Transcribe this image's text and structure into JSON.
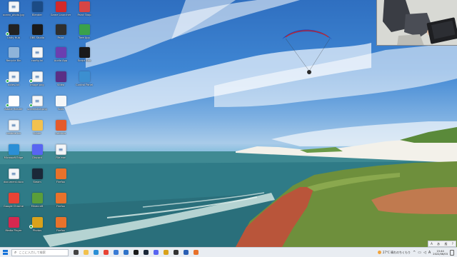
{
  "desktop": {
    "icons": [
      {
        "label": "ocean_photo.jpg",
        "icon": "file-icon",
        "color": "#f4f6f8",
        "badge": false
      },
      {
        "label": "Unity Hub",
        "icon": "unity-icon",
        "color": "#222222",
        "badge": true
      },
      {
        "label": "Recycle Bin",
        "icon": "recycle-bin-icon",
        "color": "#8fb4d9",
        "badge": false
      },
      {
        "label": "notes.txt",
        "icon": "file-icon",
        "color": "#f4f6f8",
        "badge": true
      },
      {
        "label": "Adobe Reader",
        "icon": "pdf-icon",
        "color": "#ffffff",
        "badge": true
      },
      {
        "label": "readme.txt",
        "icon": "file-icon",
        "color": "#f4f6f8",
        "badge": false
      },
      {
        "label": "Microsoft Edge",
        "icon": "edge-icon",
        "color": "#2b8fd6",
        "badge": false
      },
      {
        "label": "document.docx",
        "icon": "file-icon",
        "color": "#f4f6f8",
        "badge": false
      },
      {
        "label": "Google Chrome",
        "icon": "chrome-icon",
        "color": "#e84335",
        "badge": false
      },
      {
        "label": "Media Player",
        "icon": "media-icon",
        "color": "#d6284f",
        "badge": false
      },
      {
        "label": "Blender",
        "icon": "blender-icon",
        "color": "#1b4b85",
        "badge": false
      },
      {
        "label": "OBS Studio",
        "icon": "obs-icon",
        "color": "#1a1a1a",
        "badge": false
      },
      {
        "label": "config.ini",
        "icon": "file-icon",
        "color": "#f4f6f8",
        "badge": false
      },
      {
        "label": "image.png",
        "icon": "file-icon",
        "color": "#f4f6f8",
        "badge": true
      },
      {
        "label": "screenshot.png",
        "icon": "file-icon",
        "color": "#f4f6f8",
        "badge": true
      },
      {
        "label": "Folder",
        "icon": "folder-icon",
        "color": "#f2c14e",
        "badge": false
      },
      {
        "label": "Discord",
        "icon": "discord-icon",
        "color": "#5865f2",
        "badge": false
      },
      {
        "label": "Steam",
        "icon": "steam-icon",
        "color": "#1b2838",
        "badge": false
      },
      {
        "label": "Minecraft",
        "icon": "minecraft-icon",
        "color": "#5a9e3a",
        "badge": false
      },
      {
        "label": "Photos",
        "icon": "photos-icon",
        "color": "#d9a21b",
        "badge": true
      },
      {
        "label": "Game Launcher",
        "icon": "game-icon",
        "color": "#d2292b",
        "badge": false
      },
      {
        "label": "Paint",
        "icon": "paint-icon",
        "color": "#2f2f2f",
        "badge": false
      },
      {
        "label": "Audio App",
        "icon": "audio-icon",
        "color": "#6b3fb0",
        "badge": false
      },
      {
        "label": "Video",
        "icon": "video-icon",
        "color": "#5a2f86",
        "badge": false
      },
      {
        "label": "Tools",
        "icon": "tools-icon",
        "color": "#f4f6f8",
        "badge": false
      },
      {
        "label": "Settings",
        "icon": "settings-icon",
        "color": "#e55a2b",
        "badge": false
      },
      {
        "label": "File.exe",
        "icon": "file-icon",
        "color": "#f4f6f8",
        "badge": false
      },
      {
        "label": "Firefox",
        "icon": "firefox-icon",
        "color": "#e8722b",
        "badge": false
      },
      {
        "label": "Firefox",
        "icon": "firefox-icon",
        "color": "#e8722b",
        "badge": false
      },
      {
        "label": "Firefox",
        "icon": "firefox-icon",
        "color": "#e8722b",
        "badge": false
      },
      {
        "label": "Paint Shop",
        "icon": "paint-icon",
        "color": "#d64545",
        "badge": false
      },
      {
        "label": "Tree App",
        "icon": "tree-icon",
        "color": "#3aa14b",
        "badge": false
      },
      {
        "label": "Script App",
        "icon": "script-icon",
        "color": "#1a1a1a",
        "badge": false
      },
      {
        "label": "Control Panel",
        "icon": "control-panel-icon",
        "color": "#3c8fd0",
        "badge": false
      }
    ]
  },
  "taskbar": {
    "search_placeholder": "ここに入力して検索",
    "apps": [
      {
        "name": "task-view",
        "color": "#444444"
      },
      {
        "name": "explorer",
        "color": "#f2c14e"
      },
      {
        "name": "edge",
        "color": "#2b8fd6"
      },
      {
        "name": "chrome",
        "color": "#e84335"
      },
      {
        "name": "store",
        "color": "#3a7bd5"
      },
      {
        "name": "mail",
        "color": "#2f73c9"
      },
      {
        "name": "obs",
        "color": "#1a1a1a"
      },
      {
        "name": "steam",
        "color": "#1b2838"
      },
      {
        "name": "discord",
        "color": "#5865f2"
      },
      {
        "name": "photos",
        "color": "#d9a21b"
      },
      {
        "name": "terminal",
        "color": "#333333"
      },
      {
        "name": "word",
        "color": "#2b5fb4"
      },
      {
        "name": "firefox",
        "color": "#e8722b"
      }
    ],
    "weather_text": "27°C 晴れのちくもり",
    "time": "15:44",
    "date": "2022/06/03",
    "ime_label": "A",
    "lang_bar": [
      "A",
      "あ",
      "般",
      "?"
    ]
  }
}
